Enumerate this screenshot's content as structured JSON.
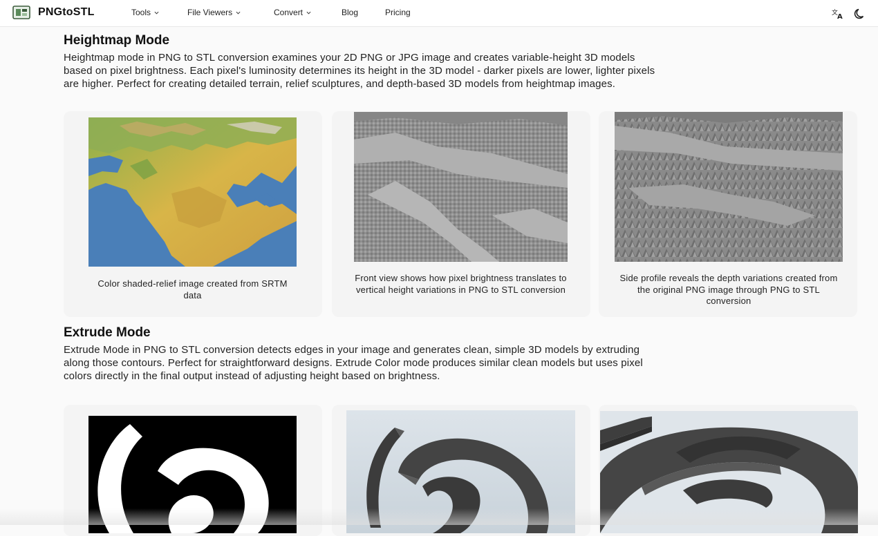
{
  "nav": {
    "brand": "PNGtoSTL",
    "items": [
      {
        "label": "Tools",
        "dropdown": true
      },
      {
        "label": "File Viewers",
        "dropdown": true
      },
      {
        "label": "Convert",
        "dropdown": true
      },
      {
        "label": "Blog",
        "dropdown": false
      },
      {
        "label": "Pricing",
        "dropdown": false
      }
    ],
    "icons": [
      "translate-icon",
      "dark-mode-icon"
    ]
  },
  "heightmap": {
    "title": "Heightmap Mode",
    "description": "Heightmap mode in PNG to STL conversion examines your 2D PNG or JPG image and creates variable-height 3D models based on pixel brightness. Each pixel's luminosity determines its height in the 3D model - darker pixels are lower, lighter pixels are higher. Perfect for creating detailed terrain, relief sculptures, and depth-based 3D models from heightmap images.",
    "cards": [
      {
        "caption": "Color shaded-relief image created from SRTM data"
      },
      {
        "caption": "Front view shows how pixel brightness translates to vertical height variations in PNG to STL conversion"
      },
      {
        "caption": "Side profile reveals the depth variations created from the original PNG image through PNG to STL conversion"
      }
    ]
  },
  "extrude": {
    "title": "Extrude Mode",
    "description": "Extrude Mode in PNG to STL conversion detects edges in your image and generates clean, simple 3D models by extruding along those contours. Perfect for straightforward designs. Extrude Color mode produces similar clean models but uses pixel colors directly in the final output instead of adjusting height based on brightness."
  },
  "colors": {
    "map_water": "#4a7fb8",
    "map_land": "#d7b445",
    "relief_gray": "#9a9a9a",
    "extrude_dark": "#4a4a4a"
  }
}
